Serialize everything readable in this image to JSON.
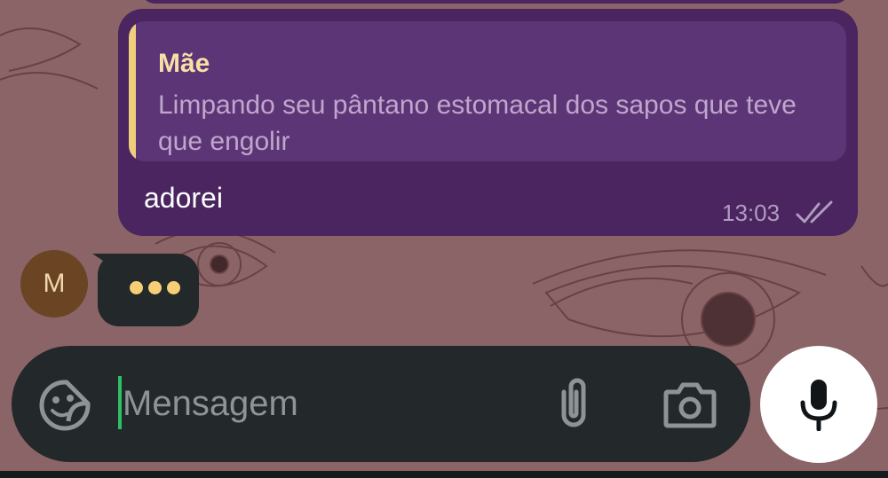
{
  "chat": {
    "reply_message": {
      "quoted_author": "Mãe",
      "quoted_text": "Limpando seu pântano estomacal dos sapos que teve que engolir",
      "text": "adorei",
      "time": "13:03",
      "status_icon": "double-check-icon"
    },
    "typing_indicator": {
      "avatar_initial": "M",
      "avatar_color": "#6b4423",
      "dots_color": "#f6ce76"
    }
  },
  "composer": {
    "placeholder": "Mensagem",
    "emoji_icon": "sticker-emoji-icon",
    "attach_icon": "paperclip-icon",
    "camera_icon": "camera-icon",
    "mic_icon": "microphone-icon"
  },
  "colors": {
    "bubble": "#4a2560",
    "quote_background": "#5c3576",
    "quote_accent": "#f0cf7c",
    "composer_background": "#23282a",
    "cursor": "#2fbf65"
  }
}
